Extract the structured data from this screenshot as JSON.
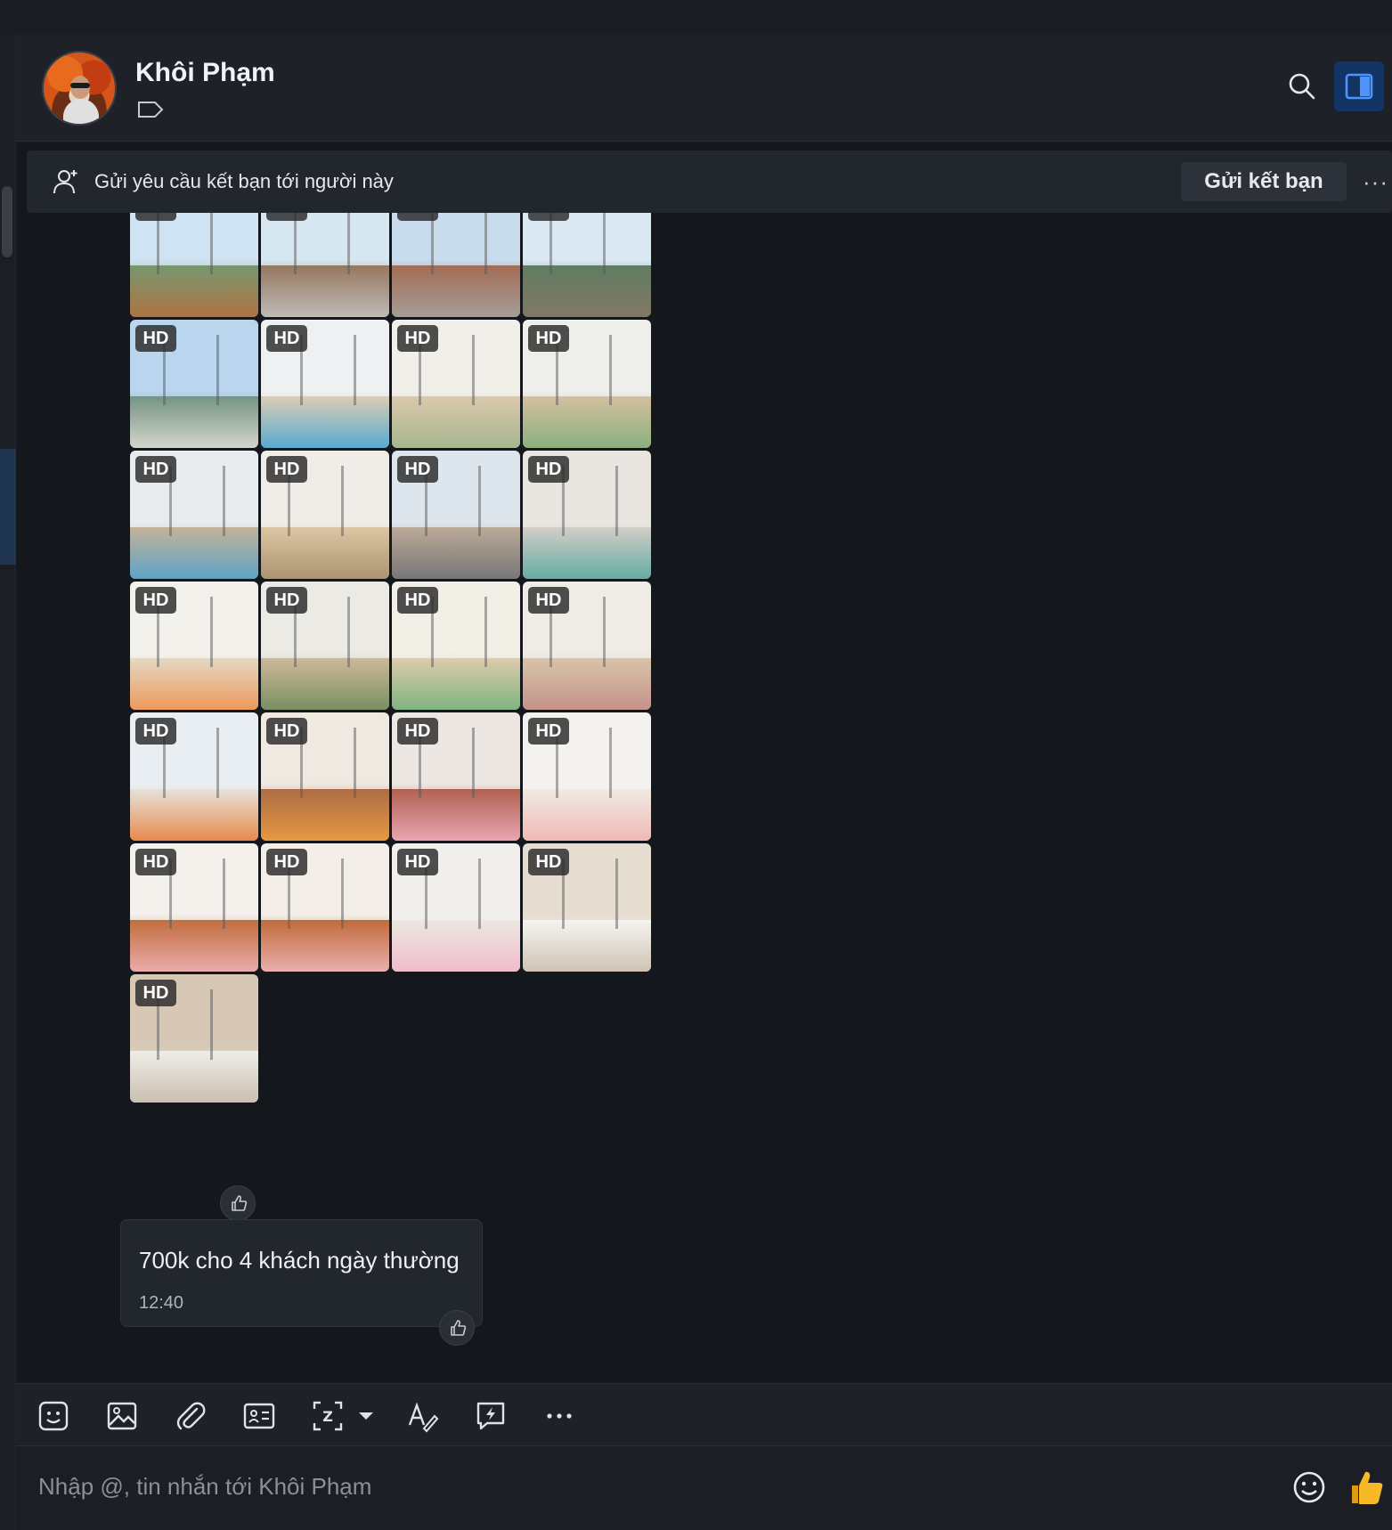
{
  "header": {
    "contact_name": "Khôi Phạm"
  },
  "friend_request": {
    "text": "Gửi yêu cầu kết bạn tới người này",
    "button_label": "Gửi kết bạn",
    "more_label": "···"
  },
  "gallery": {
    "badge": "HD",
    "photo_count": 25
  },
  "message": {
    "text": "700k cho 4 khách ngày thường",
    "time": "12:40"
  },
  "composer": {
    "placeholder": "Nhập @, tin nhắn tới Khôi Phạm",
    "tools": [
      "sticker-icon",
      "image-icon",
      "attach-icon",
      "contact-card-icon",
      "screenshot-icon",
      "text-format-icon",
      "quick-message-icon",
      "more-icon"
    ]
  },
  "colors": {
    "background": "#14171c",
    "panel": "#1e2128",
    "accent": "#2f7bf6",
    "like": "#f5b31a"
  }
}
